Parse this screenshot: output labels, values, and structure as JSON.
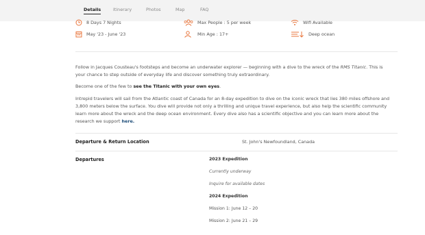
{
  "tabs": [
    {
      "label": "Details",
      "active": true
    },
    {
      "label": "Itinerary",
      "active": false
    },
    {
      "label": "Photos",
      "active": false
    },
    {
      "label": "Map",
      "active": false
    },
    {
      "label": "FAQ",
      "active": false
    }
  ],
  "features": {
    "duration": {
      "label": "8 Days 7 Nights",
      "icon": "clock-icon"
    },
    "max_people": {
      "label": "Max People : 5 per week",
      "icon": "group-icon"
    },
    "wifi": {
      "label": "Wifi Available",
      "icon": "wifi-icon"
    },
    "dates": {
      "label": "May '23 - June '23",
      "icon": "calendar-icon"
    },
    "min_age": {
      "label": "Min Age : 17+",
      "icon": "user-icon"
    },
    "depth": {
      "label": "Deep ocean",
      "icon": "depth-icon"
    }
  },
  "description": {
    "p1_a": "Follow in Jacques Cousteau's footsteps and become an underwater explorer — beginning with a dive to the wreck of the ",
    "p1_em": "RMS Titanic",
    "p1_b": ". This is your chance to step outside of everyday life and discover something truly extraordinary.",
    "p2_a": "Become one of the few to ",
    "p2_b": "see the Titanic with your own eyes",
    "p2_c": ".",
    "p3": "Intrepid travelers will sail from the Atlantic coast of Canada for an 8-day expedition to dive on the iconic wreck that lies 380 miles offshore and 3,800 meters below the surface. You dive will provide not only a thrilling and unique travel experience, but also help the scientific community learn more about the wreck and the deep ocean environment. Every dive also has a scientific objective and you can learn more about the research we support ",
    "p3_link": "here."
  },
  "departure_location": {
    "title": "Departure & Return Location",
    "value": "St. John's Newfoundland, Canada"
  },
  "departures": {
    "title": "Departures",
    "items": [
      {
        "text": "2023 Expedition",
        "style": "bold"
      },
      {
        "text": "Currently underway",
        "style": "ital"
      },
      {
        "text": "Inquire for available dates",
        "style": "ital"
      },
      {
        "text": "2024 Expedition",
        "style": "bold"
      },
      {
        "text": "Mission 1: June 12 – 20",
        "style": "plain"
      },
      {
        "text": "Mission 2: June 21 – 29",
        "style": "plain"
      }
    ]
  },
  "colors": {
    "accent": "#e8743b",
    "link": "#1f4e79",
    "tabbar": "#f3f3f3"
  }
}
